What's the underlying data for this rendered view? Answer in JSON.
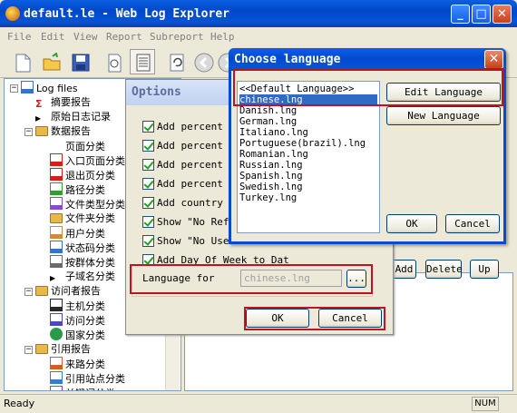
{
  "main_window": {
    "title": "default.le - Web Log Explorer",
    "menu": [
      "File",
      "Edit",
      "View",
      "Report",
      "Subreport",
      "Help"
    ],
    "status_left": "Ready",
    "status_right": "NUM"
  },
  "tree": {
    "items": [
      {
        "label": "Log files",
        "icon": "log-files-icon"
      },
      {
        "label": "摘要报告",
        "icon": "sigma-icon"
      },
      {
        "label": "原始日志记录",
        "icon": "arrow-right-icon"
      },
      {
        "label": "数据报告",
        "icon": "folder-icon"
      },
      {
        "label": "页面分类",
        "icon": "page-icon"
      },
      {
        "label": "入口页面分类",
        "icon": "entry-page-icon"
      },
      {
        "label": "退出页分类",
        "icon": "exit-page-icon"
      },
      {
        "label": "路径分类",
        "icon": "path-icon"
      },
      {
        "label": "文件类型分类",
        "icon": "filetype-icon"
      },
      {
        "label": "文件夹分类",
        "icon": "folder-icon"
      },
      {
        "label": "用户分类",
        "icon": "user-icon"
      },
      {
        "label": "状态码分类",
        "icon": "status-icon"
      },
      {
        "label": "按群体分类",
        "icon": "group-icon"
      },
      {
        "label": "子域名分类",
        "icon": "arrow-right-icon"
      },
      {
        "label": "访问者报告",
        "icon": "folder-icon"
      },
      {
        "label": "主机分类",
        "icon": "host-icon"
      },
      {
        "label": "访问分类",
        "icon": "visit-icon"
      },
      {
        "label": "国家分类",
        "icon": "globe-icon"
      },
      {
        "label": "引用报告",
        "icon": "folder-icon"
      },
      {
        "label": "来路分类",
        "icon": "referrer-icon"
      },
      {
        "label": "引用站点分类",
        "icon": "referrer-site-icon"
      },
      {
        "label": "关键词分类",
        "icon": "keyword-icon"
      }
    ]
  },
  "options_dialog": {
    "title": "Options",
    "checkboxes": [
      {
        "label": "Add percent t",
        "checked": true
      },
      {
        "label": "Add percent t",
        "checked": true
      },
      {
        "label": "Add percent t",
        "checked": true
      },
      {
        "label": "Add percent t",
        "checked": true
      },
      {
        "label": "Add country t",
        "checked": true
      },
      {
        "label": "Show \"No Refe",
        "checked": true
      },
      {
        "label": "Show \"No User",
        "checked": true
      },
      {
        "label": "Add Day Of Week to Dat",
        "checked": true
      }
    ],
    "language_label": "Language for",
    "language_value": "chinese.lng",
    "browse_label": "...",
    "ok_label": "OK",
    "cancel_label": "Cancel"
  },
  "side_buttons": {
    "add": "Add",
    "delete": "Delete",
    "up": "Up"
  },
  "choose_language_dialog": {
    "title": "Choose language",
    "languages": [
      "<<Default Language>>",
      "chinese.lng",
      "Danish.lng",
      "German.lng",
      "Italiano.lng",
      "Portuguese(brazil).lng",
      "Romanian.lng",
      "Russian.lng",
      "Spanish.lng",
      "Swedish.lng",
      "Turkey.lng"
    ],
    "selected": "chinese.lng",
    "edit_label": "Edit Language",
    "new_label": "New Language",
    "ok_label": "OK",
    "cancel_label": "Cancel"
  },
  "colors": {
    "xp_blue": "#0454d6",
    "selection": "#316ac5",
    "highlight_red": "#c0131f",
    "dialog_face": "#ece9d8"
  }
}
